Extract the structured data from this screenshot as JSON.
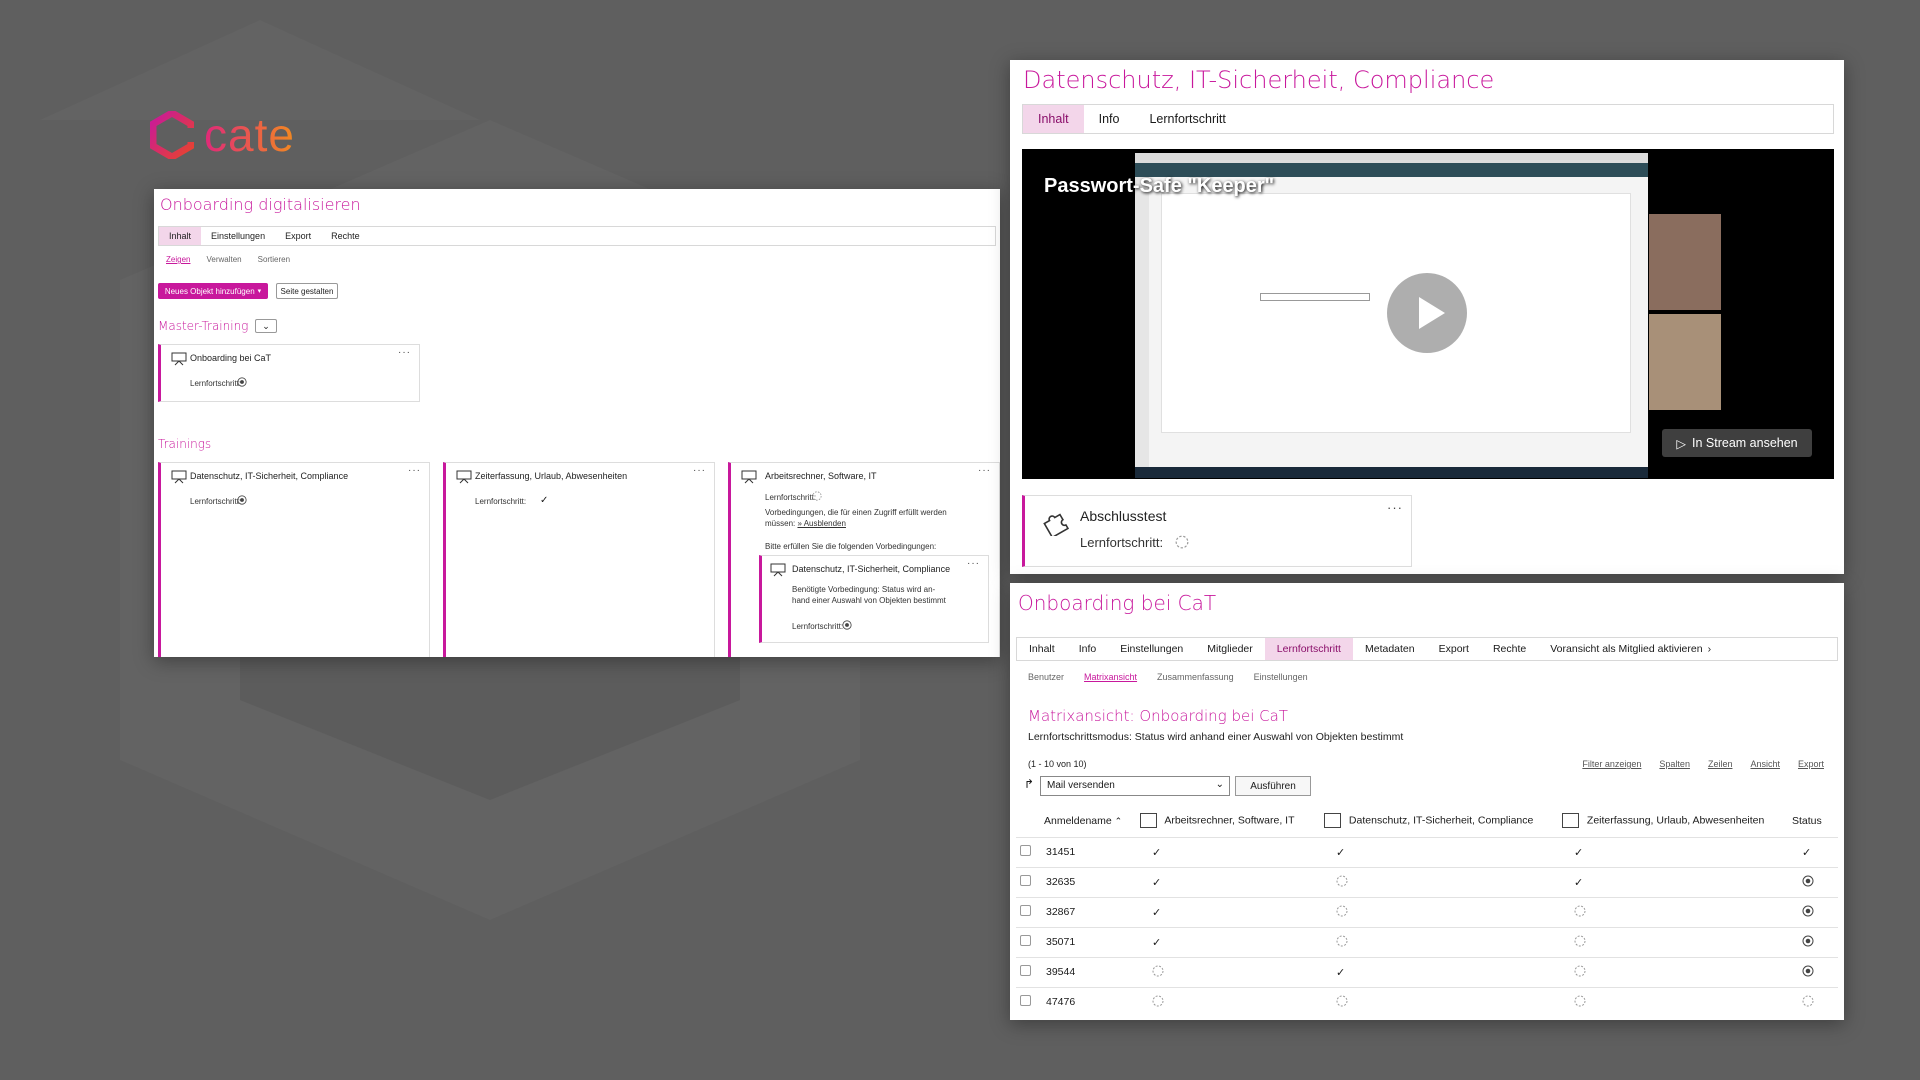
{
  "brand": {
    "name": "cate"
  },
  "onboarding_panel": {
    "title": "Onboarding digitalisieren",
    "tabs": [
      "Inhalt",
      "Einstellungen",
      "Export",
      "Rechte"
    ],
    "subtabs": [
      "Zeigen",
      "Verwalten",
      "Sortieren"
    ],
    "add_button": "Neues Objekt hinzufügen",
    "layout_button": "Seite gestalten",
    "master_title": "Master-Training",
    "master_card": {
      "title": "Onboarding bei CaT",
      "label": "Lernfortschritt:"
    },
    "trainings_title": "Trainings",
    "cards": [
      {
        "title": "Datenschutz, IT-Sicherheit, Compliance",
        "label": "Lernfortschritt:"
      },
      {
        "title": "Zeiterfassung, Urlaub, Abwesenheiten",
        "label": "Lernfortschritt:"
      },
      {
        "title": "Arbeitsrechner, Software, IT",
        "label": "Lernfortschritt:",
        "prereq_text": "Vorbedingungen, die für einen Zugriff erfüllt werden müssen:",
        "hide_link": "» Ausblenden",
        "fulfil_text": "Bitte erfüllen Sie die folgenden Vorbedingungen:",
        "nested": {
          "title": "Datenschutz, IT-Sicherheit, Compliance",
          "text": "Benötigte Vorbedingung: Status wird an-hand einer Auswahl von Objekten bestimmt",
          "label": "Lernfortschritt:"
        }
      }
    ]
  },
  "course_panel": {
    "title": "Datenschutz, IT-Sicherheit, Compliance",
    "tabs": [
      "Inhalt",
      "Info",
      "Lernfortschritt"
    ],
    "video": {
      "title": "Passwort-Safe \"Keeper\"",
      "stream_button": "In Stream ansehen"
    },
    "test_card": {
      "title": "Abschlusstest",
      "label": "Lernfortschritt:"
    }
  },
  "matrix_panel": {
    "title": "Onboarding bei CaT",
    "tabs": [
      "Inhalt",
      "Info",
      "Einstellungen",
      "Mitglieder",
      "Lernfortschritt",
      "Metadaten",
      "Export",
      "Rechte",
      "Voransicht als Mitglied aktivieren"
    ],
    "subtabs": [
      "Benutzer",
      "Matrixansicht",
      "Zusammenfassung",
      "Einstellungen"
    ],
    "heading": "Matrixansicht: Onboarding bei CaT",
    "mode_text": "Lernfortschrittsmodus: Status wird anhand einer Auswahl von Objekten bestimmt",
    "count": "(1 - 10 von 10)",
    "tools": [
      "Filter anzeigen",
      "Spalten",
      "Zeilen",
      "Ansicht",
      "Export"
    ],
    "action_select": "Mail versenden",
    "execute_button": "Ausführen",
    "columns": [
      "Anmeldename",
      "Arbeitsrechner, Software, IT",
      "Datenschutz, IT-Sicherheit, Compliance",
      "Zeiterfassung, Urlaub, Abwesenheiten",
      "Status"
    ],
    "rows": [
      {
        "id": "31451",
        "s": [
          "done",
          "done",
          "done",
          "done"
        ]
      },
      {
        "id": "32635",
        "s": [
          "done",
          "none",
          "done",
          "progress"
        ]
      },
      {
        "id": "32867",
        "s": [
          "done",
          "none",
          "none",
          "progress"
        ]
      },
      {
        "id": "35071",
        "s": [
          "done",
          "none",
          "none",
          "progress"
        ]
      },
      {
        "id": "39544",
        "s": [
          "none",
          "done",
          "none",
          "progress"
        ]
      },
      {
        "id": "47476",
        "s": [
          "none",
          "none",
          "none",
          "none"
        ]
      }
    ]
  },
  "colors": {
    "accent": "#c8189c",
    "background": "#5f5f5f"
  }
}
